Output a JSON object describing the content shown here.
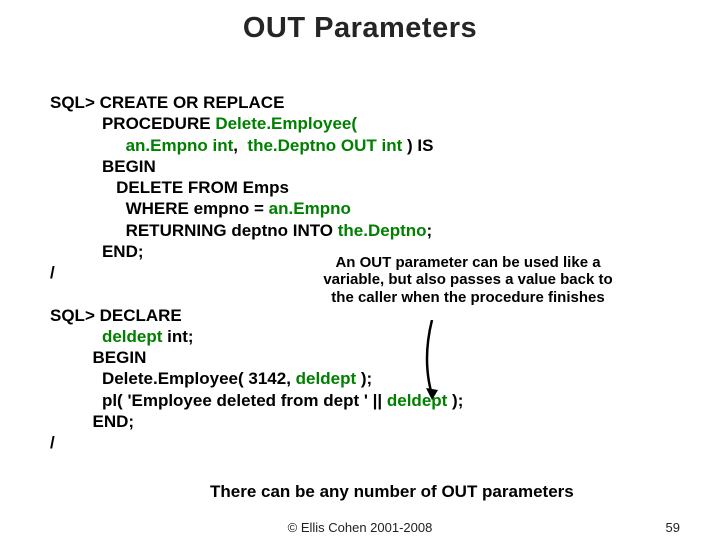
{
  "title": "OUT Parameters",
  "code": {
    "l1": "SQL> CREATE OR REPLACE",
    "l2": "           PROCEDURE ",
    "l2b": "Delete.Employee(",
    "l3a": "                ",
    "l3b": "an.Empno int",
    "l3c": ",  ",
    "l3d": "the.Deptno OUT int",
    "l3e": " ) IS",
    "l4": "           BEGIN",
    "l5": "              DELETE FROM Emps",
    "l6a": "                WHERE empno = ",
    "l6b": "an.Empno",
    "l7a": "                RETURNING deptno INTO ",
    "l7b": "the.Deptno",
    "l7c": ";",
    "l8": "           END;",
    "l9": "/",
    "l10": "",
    "l11": "SQL> DECLARE",
    "l12a": "           ",
    "l12b": "deldept",
    "l12c": " int;",
    "l13": "         BEGIN",
    "l14a": "           Delete.Employee( 3142, ",
    "l14b": "deldept",
    "l14c": " );",
    "l15a": "           pl( 'Employee deleted from dept ' || ",
    "l15b": "deldept",
    "l15c": " );",
    "l16": "         END;",
    "l17": "/"
  },
  "callout": "An OUT parameter can be used like a variable, but also passes a value back to the caller when the procedure finishes",
  "bottom_note": "There can be any number of OUT parameters",
  "copyright": "© Ellis Cohen 2001-2008",
  "page_number": "59"
}
